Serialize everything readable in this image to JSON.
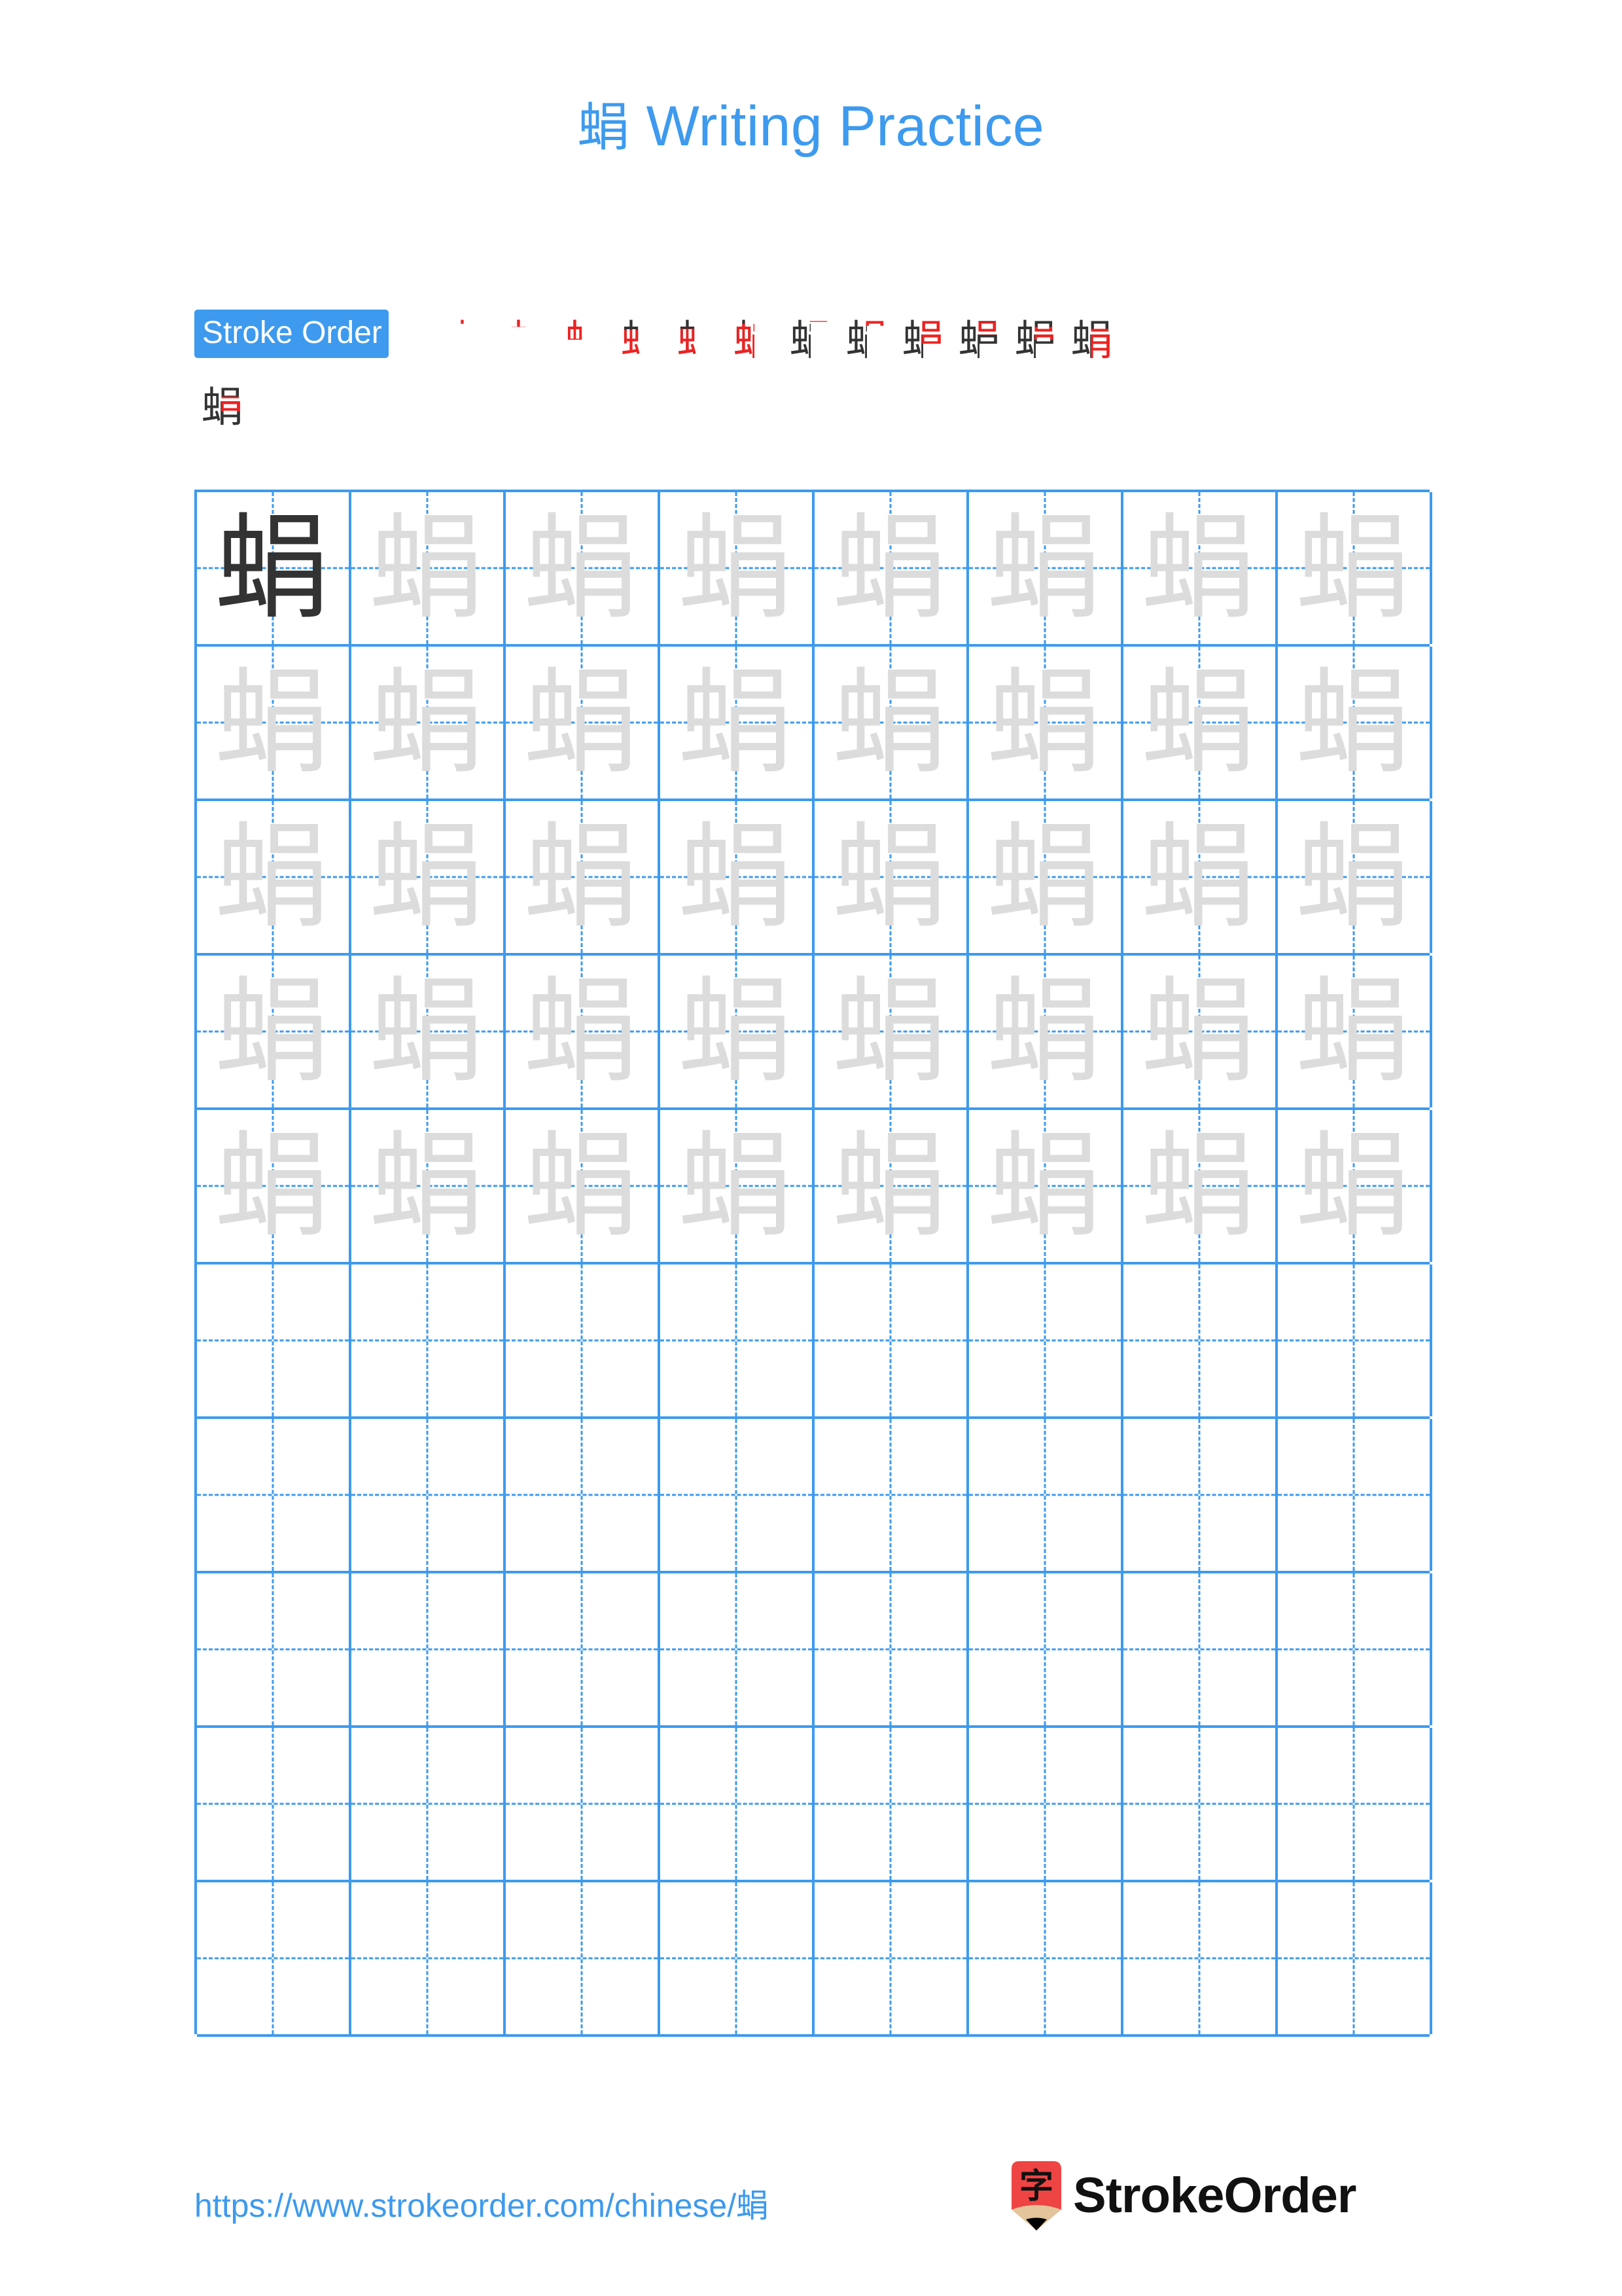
{
  "document": {
    "character": "蜎",
    "title_suffix": " Writing Practice",
    "title_full": "蜎 Writing Practice",
    "accent_color": "#3d9aee",
    "stroke_new_color": "#ee2222",
    "stroke_done_color": "#333333",
    "traced_char_color": "#dcdcdc",
    "solid_char_color": "#333333"
  },
  "stroke_order": {
    "badge_label": "Stroke Order",
    "total_strokes": 14,
    "steps_row_1": [
      {
        "index": 1,
        "glyph": "丶"
      },
      {
        "index": 2,
        "glyph": "𠃌"
      },
      {
        "index": 3,
        "glyph": "口"
      },
      {
        "index": 4,
        "glyph": "中"
      },
      {
        "index": 5,
        "glyph": "虫"
      },
      {
        "index": 6,
        "glyph": "虫"
      },
      {
        "index": 7,
        "glyph": "虫丶"
      },
      {
        "index": 8,
        "glyph": "虫𠃌"
      },
      {
        "index": 9,
        "glyph": "虫𠃌"
      },
      {
        "index": 10,
        "glyph": "虫𠃌"
      },
      {
        "index": 11,
        "glyph": "蜎"
      },
      {
        "index": 12,
        "glyph": "蜎"
      },
      {
        "index": 13,
        "glyph": "蜎"
      }
    ],
    "steps_row_2": [
      {
        "index": 14,
        "glyph": "蜎"
      }
    ]
  },
  "practice_grid": {
    "columns": 8,
    "rows": 10,
    "rows_data": [
      {
        "row": 1,
        "cells": [
          "蜎",
          "蜎",
          "蜎",
          "蜎",
          "蜎",
          "蜎",
          "蜎",
          "蜎"
        ],
        "styles": [
          "dark",
          "faded",
          "faded",
          "faded",
          "faded",
          "faded",
          "faded",
          "faded"
        ]
      },
      {
        "row": 2,
        "cells": [
          "蜎",
          "蜎",
          "蜎",
          "蜎",
          "蜎",
          "蜎",
          "蜎",
          "蜎"
        ],
        "styles": [
          "faded",
          "faded",
          "faded",
          "faded",
          "faded",
          "faded",
          "faded",
          "faded"
        ]
      },
      {
        "row": 3,
        "cells": [
          "蜎",
          "蜎",
          "蜎",
          "蜎",
          "蜎",
          "蜎",
          "蜎",
          "蜎"
        ],
        "styles": [
          "faded",
          "faded",
          "faded",
          "faded",
          "faded",
          "faded",
          "faded",
          "faded"
        ]
      },
      {
        "row": 4,
        "cells": [
          "蜎",
          "蜎",
          "蜎",
          "蜎",
          "蜎",
          "蜎",
          "蜎",
          "蜎"
        ],
        "styles": [
          "faded",
          "faded",
          "faded",
          "faded",
          "faded",
          "faded",
          "faded",
          "faded"
        ]
      },
      {
        "row": 5,
        "cells": [
          "蜎",
          "蜎",
          "蜎",
          "蜎",
          "蜎",
          "蜎",
          "蜎",
          "蜎"
        ],
        "styles": [
          "faded",
          "faded",
          "faded",
          "faded",
          "faded",
          "faded",
          "faded",
          "faded"
        ]
      },
      {
        "row": 6,
        "cells": [
          "",
          "",
          "",
          "",
          "",
          "",
          "",
          ""
        ],
        "styles": [
          "empty",
          "empty",
          "empty",
          "empty",
          "empty",
          "empty",
          "empty",
          "empty"
        ]
      },
      {
        "row": 7,
        "cells": [
          "",
          "",
          "",
          "",
          "",
          "",
          "",
          ""
        ],
        "styles": [
          "empty",
          "empty",
          "empty",
          "empty",
          "empty",
          "empty",
          "empty",
          "empty"
        ]
      },
      {
        "row": 8,
        "cells": [
          "",
          "",
          "",
          "",
          "",
          "",
          "",
          ""
        ],
        "styles": [
          "empty",
          "empty",
          "empty",
          "empty",
          "empty",
          "empty",
          "empty",
          "empty"
        ]
      },
      {
        "row": 9,
        "cells": [
          "",
          "",
          "",
          "",
          "",
          "",
          "",
          ""
        ],
        "styles": [
          "empty",
          "empty",
          "empty",
          "empty",
          "empty",
          "empty",
          "empty",
          "empty"
        ]
      },
      {
        "row": 10,
        "cells": [
          "",
          "",
          "",
          "",
          "",
          "",
          "",
          ""
        ],
        "styles": [
          "empty",
          "empty",
          "empty",
          "empty",
          "empty",
          "empty",
          "empty",
          "empty"
        ]
      }
    ]
  },
  "footer": {
    "url": "https://www.strokeorder.com/chinese/蜎",
    "brand_name": "StrokeOrder",
    "logo_char": "字",
    "logo_body_color": "#ee4444",
    "logo_tip_color": "#e3c49b",
    "logo_point_color": "#000000"
  }
}
